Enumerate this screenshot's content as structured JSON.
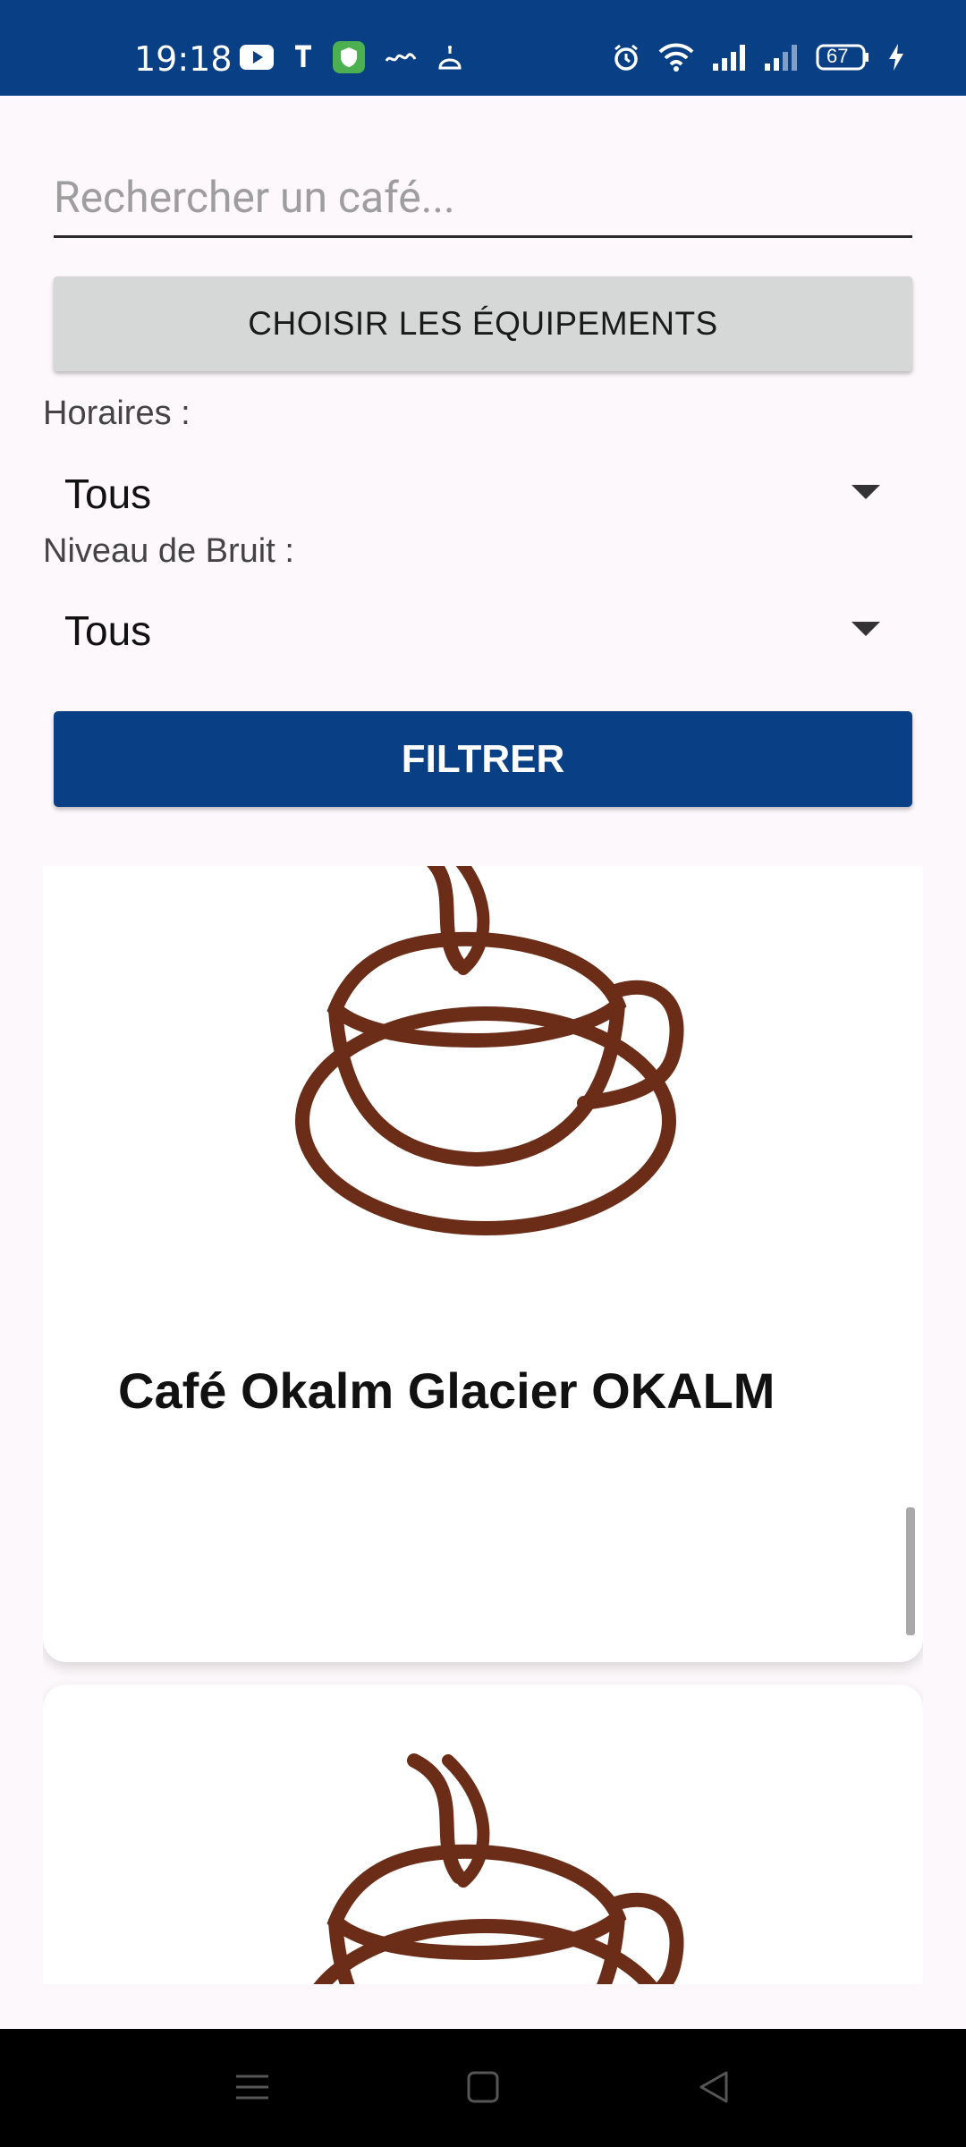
{
  "status_bar": {
    "time": "19:18",
    "left_icons": [
      "youtube-icon",
      "t-icon",
      "vpn-shield-icon",
      "arabic-app-icon",
      "mosque-icon"
    ],
    "right_icons": [
      "alarm-icon",
      "wifi-icon",
      "signal-icon",
      "signal-icon"
    ],
    "battery_level": "67",
    "charging": true
  },
  "search": {
    "placeholder": "Rechercher un café..."
  },
  "equipment_button": {
    "label": "CHOISIR LES ÉQUIPEMENTS"
  },
  "filters": {
    "hours_label": "Horaires :",
    "hours_value": "Tous",
    "noise_label": "Niveau de Bruit :",
    "noise_value": "Tous"
  },
  "filter_button": {
    "label": "FILTRER"
  },
  "cafes": [
    {
      "name": "Café Okalm Glacier OKALM",
      "image": "coffee-cup-icon"
    },
    {
      "name": "",
      "image": "coffee-cup-icon"
    }
  ],
  "colors": {
    "primary": "#083f85",
    "button_grey": "#d6d7d7",
    "coffee_brown": "#6b2d17",
    "background": "#fdf8fb"
  },
  "nav_bar": {
    "buttons": [
      "menu-icon",
      "home-icon",
      "back-icon"
    ]
  }
}
